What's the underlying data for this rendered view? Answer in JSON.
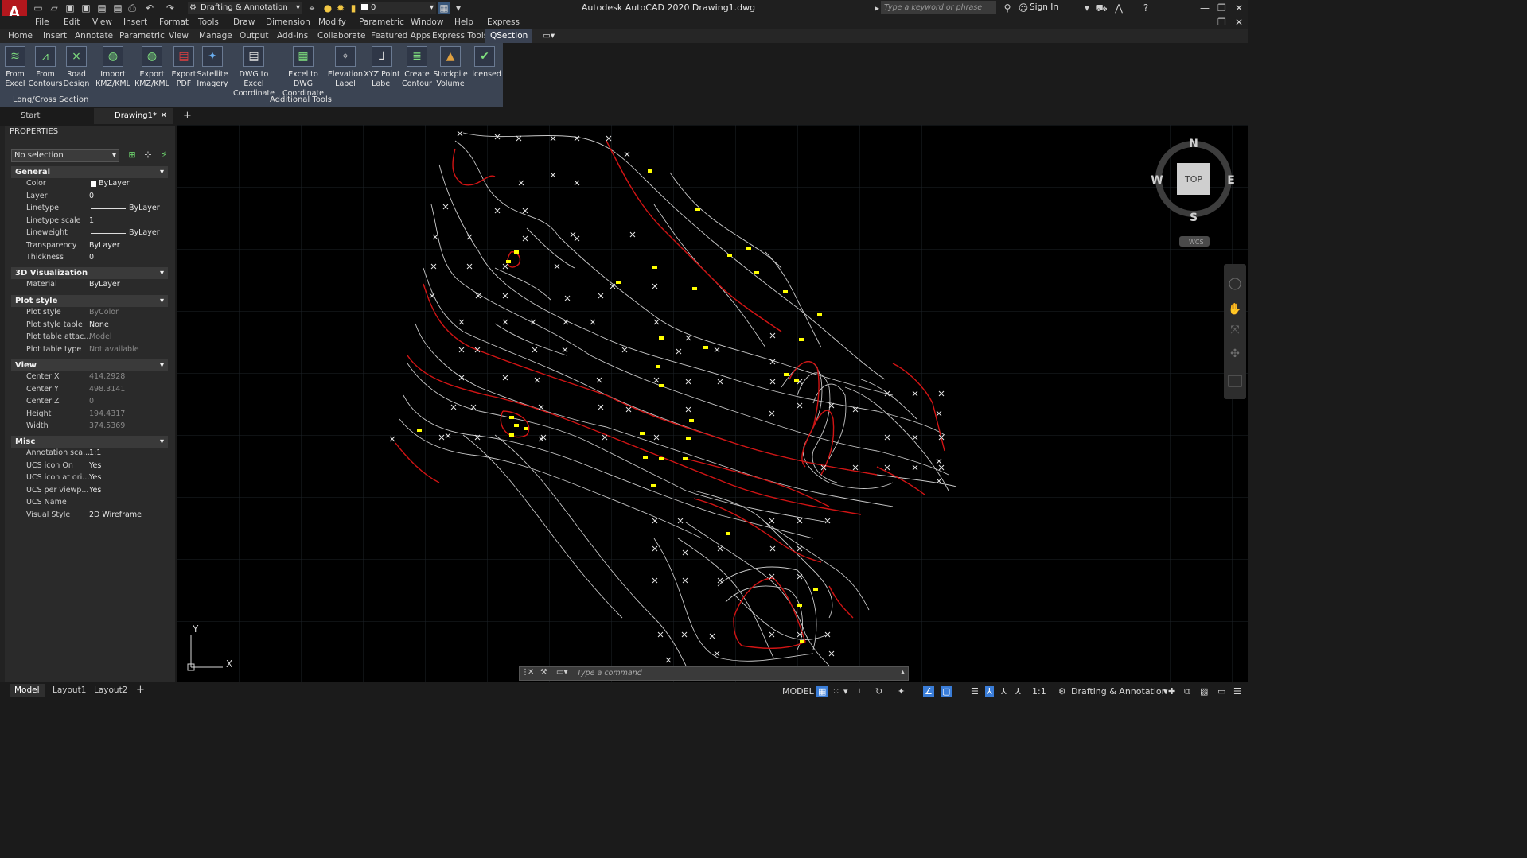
{
  "title_bar": {
    "app_logo": "A",
    "workspace": "Drafting & Annotation",
    "layer_value": "0",
    "window_title": "Autodesk AutoCAD 2020    Drawing1.dwg",
    "search_placeholder": "Type a keyword or phrase",
    "sign_in": "Sign In"
  },
  "menu": [
    "File",
    "Edit",
    "View",
    "Insert",
    "Format",
    "Tools",
    "Draw",
    "Dimension",
    "Modify",
    "Parametric",
    "Window",
    "Help",
    "Express"
  ],
  "ribbon_tabs": [
    "Home",
    "Insert",
    "Annotate",
    "Parametric",
    "View",
    "Manage",
    "Output",
    "Add-ins",
    "Collaborate",
    "Featured Apps",
    "Express Tools",
    "QSection"
  ],
  "ribbon": {
    "buttons": [
      {
        "line1": "From",
        "line2": "Excel"
      },
      {
        "line1": "From",
        "line2": "Contours"
      },
      {
        "line1": "Road",
        "line2": "Design"
      },
      {
        "line1": "Import",
        "line2": "KMZ/KML"
      },
      {
        "line1": "Export",
        "line2": "KMZ/KML"
      },
      {
        "line1": "Export",
        "line2": "PDF"
      },
      {
        "line1": "Satellite",
        "line2": "Imagery"
      },
      {
        "line1": "DWG to Excel",
        "line2": "Coordinate"
      },
      {
        "line1": "Excel to DWG",
        "line2": "Coordinate"
      },
      {
        "line1": "Elevation",
        "line2": "Label"
      },
      {
        "line1": "XYZ Point",
        "line2": "Label"
      },
      {
        "line1": "Create",
        "line2": "Contour"
      },
      {
        "line1": "Stockpile",
        "line2": "Volume"
      },
      {
        "line1": "Licensed",
        "line2": ""
      }
    ],
    "panels": [
      "Long/Cross Section",
      "Additional Tools"
    ]
  },
  "file_tabs": [
    "Start",
    "Drawing1*"
  ],
  "properties": {
    "title": "PROPERTIES",
    "selection": "No selection",
    "sections": {
      "general": "General",
      "visualization": "3D Visualization",
      "plot_style": "Plot style",
      "view": "View",
      "misc": "Misc"
    },
    "general": [
      {
        "key": "Color",
        "value": "ByLayer"
      },
      {
        "key": "Layer",
        "value": "0"
      },
      {
        "key": "Linetype",
        "value": "ByLayer"
      },
      {
        "key": "Linetype scale",
        "value": "1"
      },
      {
        "key": "Lineweight",
        "value": "ByLayer"
      },
      {
        "key": "Transparency",
        "value": "ByLayer"
      },
      {
        "key": "Thickness",
        "value": "0"
      }
    ],
    "visualization": [
      {
        "key": "Material",
        "value": "ByLayer"
      }
    ],
    "plot_style": [
      {
        "key": "Plot style",
        "value": "ByColor"
      },
      {
        "key": "Plot style table",
        "value": "None"
      },
      {
        "key": "Plot table attac...",
        "value": "Model"
      },
      {
        "key": "Plot table type",
        "value": "Not available"
      }
    ],
    "view": [
      {
        "key": "Center X",
        "value": "414.2928"
      },
      {
        "key": "Center Y",
        "value": "498.3141"
      },
      {
        "key": "Center Z",
        "value": "0"
      },
      {
        "key": "Height",
        "value": "194.4317"
      },
      {
        "key": "Width",
        "value": "374.5369"
      }
    ],
    "misc": [
      {
        "key": "Annotation sca...",
        "value": "1:1"
      },
      {
        "key": "UCS icon On",
        "value": "Yes"
      },
      {
        "key": "UCS icon at ori...",
        "value": "Yes"
      },
      {
        "key": "UCS per viewp...",
        "value": "Yes"
      },
      {
        "key": "UCS Name",
        "value": ""
      },
      {
        "key": "Visual Style",
        "value": "2D Wireframe"
      }
    ]
  },
  "viewcube": {
    "n": "N",
    "s": "S",
    "e": "E",
    "w": "W",
    "top": "TOP",
    "wcs": "WCS"
  },
  "ucs": {
    "x": "X",
    "y": "Y"
  },
  "command_line": {
    "placeholder": "Type a command"
  },
  "layout_tabs": [
    "Model",
    "Layout1",
    "Layout2"
  ],
  "status_bar": {
    "model": "MODEL",
    "scale": "1:1",
    "workspace": "Drafting & Annotation"
  },
  "colors": {
    "contour_gray": "#cfcfcf",
    "contour_red": "#d21414",
    "label_yellow": "#ffff00",
    "background": "#000000"
  }
}
